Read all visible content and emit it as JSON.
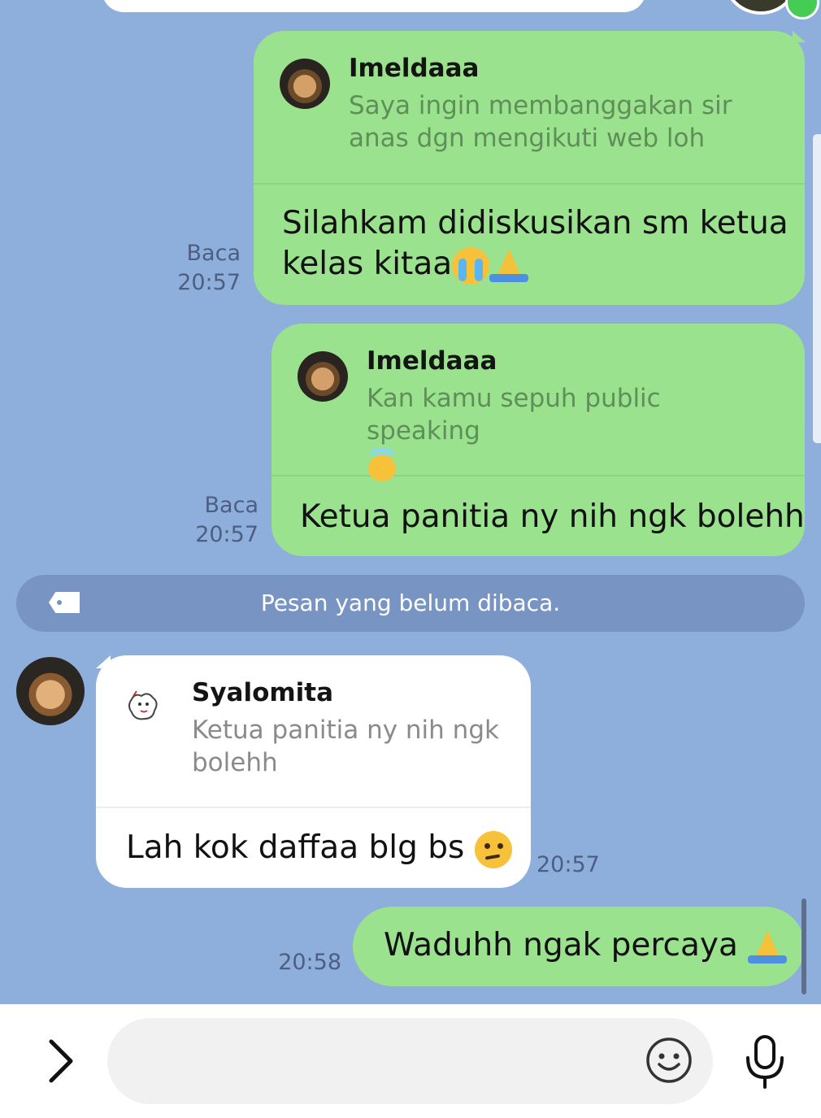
{
  "messages": [
    {
      "direction": "outgoing",
      "quote": {
        "name": "Imeldaaa",
        "text": "Saya ingin membanggakan sir anas dgn mengikuti web loh"
      },
      "text": "Silahkam didiskusikan sm ketua kelas kitaa",
      "text_line1": "Silahkam didiskusikan sm ketua",
      "text_line2": "kelas kitaa",
      "emojis": [
        "loudly-crying-face",
        "folded-hands"
      ],
      "status": "Baca",
      "time": "20:57"
    },
    {
      "direction": "outgoing",
      "quote": {
        "name": "Imeldaaa",
        "text": "Kan kamu sepuh public speaking",
        "emoji": "smiling-face-with-halo"
      },
      "text": "Ketua panitia ny nih ngk bolehh",
      "status": "Baca",
      "time": "20:57"
    },
    {
      "direction": "incoming",
      "quote": {
        "name": "Syalomita",
        "text": "Ketua panitia ny nih ngk bolehh"
      },
      "text": "Lah kok daffaa blg bs",
      "emoji": "face-with-raised-eyebrow",
      "time": "20:57"
    },
    {
      "direction": "outgoing",
      "text": "Waduhh ngak percaya",
      "emoji": "folded-hands",
      "time": "20:58"
    }
  ],
  "unread_divider": {
    "label": "Pesan yang belum dibaca.",
    "icon": "tag-icon"
  },
  "input_bar": {
    "placeholder": "",
    "expand_icon": "chevron-right-icon",
    "emoji_icon": "smiley-icon",
    "mic_icon": "microphone-icon"
  },
  "colors": {
    "background": "#8eaedc",
    "outgoing_bubble": "#9be28f",
    "incoming_bubble": "#ffffff",
    "unread_bar": "#7894c2",
    "quote_text_outgoing": "#5f8f58",
    "quote_text_incoming": "#8a8a8a"
  }
}
